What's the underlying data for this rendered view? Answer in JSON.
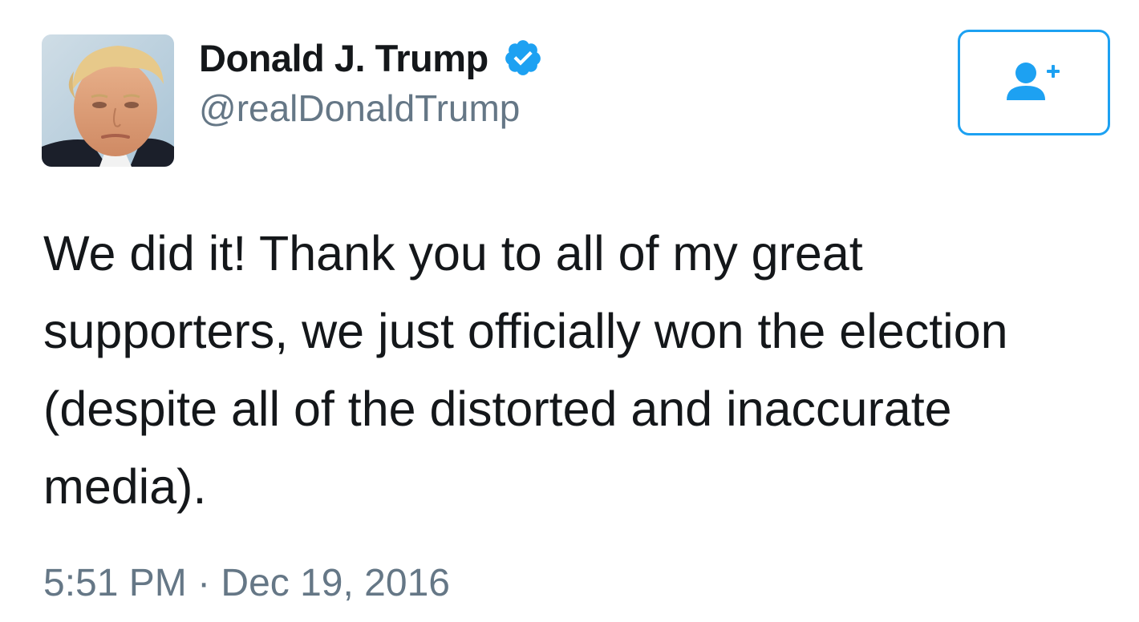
{
  "author": {
    "display_name": "Donald J. Trump",
    "screen_name": "@realDonaldTrump",
    "verified_icon": "verified-badge-icon",
    "avatar_icon": "profile-photo"
  },
  "follow_button": {
    "icon": "follow-user-plus-icon"
  },
  "tweet": {
    "lines": [
      "We did it! Thank you to all of my great",
      "supporters, we just officially won the election",
      "(despite all of the distorted and inaccurate",
      "media)."
    ],
    "timestamp": "5:51 PM · Dec 19, 2016"
  },
  "colors": {
    "accent": "#1da1f2",
    "secondary_text": "#657786",
    "primary_text": "#14171a"
  }
}
